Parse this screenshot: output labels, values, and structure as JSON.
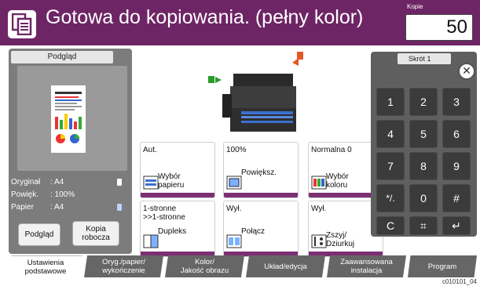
{
  "header": {
    "title": "Gotowa do kopiowania. (pełny kolor)",
    "copies_label": "Kopie",
    "copies_value": "50",
    "icon": "copy-icon"
  },
  "preview": {
    "heading": "Podgląd",
    "info": [
      {
        "label": "Oryginał",
        "value": ": A4"
      },
      {
        "label": "Powięk.",
        "value": ": 100%"
      },
      {
        "label": "Papier",
        "value": ": A4"
      }
    ],
    "buttons": {
      "preview": "Podgląd",
      "draft_line1": "Kopia",
      "draft_line2": "robocza"
    }
  },
  "tiles": [
    {
      "value": "Aut.",
      "label_line1": "Wybór",
      "label_line2": "papieru",
      "icon": "paper-select-icon"
    },
    {
      "value": "100%",
      "label_line1": "Powiększ.",
      "label_line2": "",
      "icon": "zoom-icon"
    },
    {
      "value": "Normalna 0",
      "label_line1": "Wybór",
      "label_line2": "koloru",
      "icon": "color-select-icon"
    },
    {
      "value": "1-stronne",
      "value_line2": ">>1-stronne",
      "label_line1": "Dupleks",
      "label_line2": "",
      "icon": "duplex-icon"
    },
    {
      "value": "Wył.",
      "label_line1": "Połącz",
      "label_line2": "",
      "icon": "combine-icon"
    },
    {
      "value": "Wył.",
      "label_line1": "Zszyj/",
      "label_line2": "Dziurkuj",
      "icon": "staple-icon"
    }
  ],
  "keypad": {
    "shortcut": "Skrót 1",
    "keys": [
      "1",
      "2",
      "3",
      "4",
      "5",
      "6",
      "7",
      "8",
      "9",
      "*/.",
      "0",
      "#",
      "C",
      "⌗",
      "↵"
    ]
  },
  "tabs": [
    {
      "line1": "Ustawienia",
      "line2": "podstawowe"
    },
    {
      "line1": "Oryg./papier/",
      "line2": "wykończenie"
    },
    {
      "line1": "Kolor/",
      "line2": "Jakość obrazu"
    },
    {
      "line1": "Układ/edycja",
      "line2": ""
    },
    {
      "line1": "Zaawansowana",
      "line2": "instalacja"
    },
    {
      "line1": "Program",
      "line2": ""
    }
  ],
  "footer_code": "c010101_04",
  "colors": {
    "header": "#6e2565",
    "accent": "#7c2f73"
  }
}
